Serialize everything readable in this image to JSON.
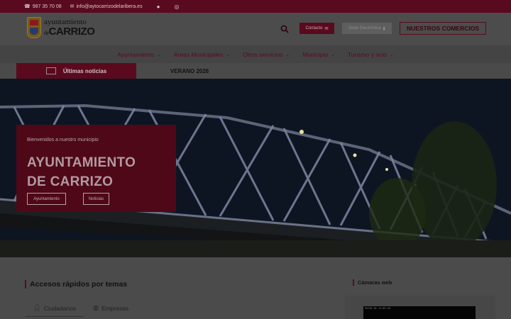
{
  "topbar": {
    "phone": "987 35 70 08",
    "email": "info@aytocarrizodelaribera.es",
    "social": [
      "facebook-icon",
      "instagram-icon"
    ]
  },
  "header": {
    "logo_line1": "ayuntamiento",
    "logo_line2_prefix": "de",
    "logo_line2": "CARRIZO",
    "contact_label": "Contacto",
    "sede_label": "Sede Electrónica",
    "comercios_label": "NUESTROS COMERCIOS"
  },
  "nav": {
    "items": [
      {
        "label": "Ayuntamiento"
      },
      {
        "label": "Áreas Municipales"
      },
      {
        "label": "Otros servicios"
      },
      {
        "label": "Municipio"
      },
      {
        "label": "Turismo y ocio"
      }
    ]
  },
  "news": {
    "tab_label": "Últimas noticias",
    "headline": "VERANO 2026"
  },
  "hero": {
    "welcome": "Bienvenidos a nuestro municipio",
    "title_line1": "AYUNTAMIENTO",
    "title_line2": "DE CARRIZO",
    "btn1": "Ayuntamiento",
    "btn2": "Noticias"
  },
  "quick_access": {
    "title": "Accesos rápidos por temas",
    "tabs": [
      {
        "label": "Ciudadanos"
      },
      {
        "label": "Empresas"
      }
    ]
  },
  "cams": {
    "title": "Cámaras web",
    "cam_label": "PATIO 01 11:02:44"
  },
  "colors": {
    "brand": "#5a0a1e",
    "overlay_gray": "#4a4a4a"
  }
}
